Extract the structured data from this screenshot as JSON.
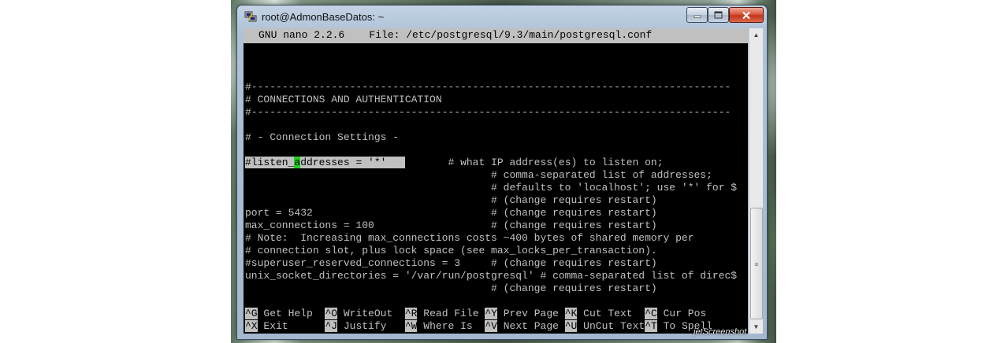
{
  "window": {
    "title": "root@AdmonBaseDatos: ~",
    "icon": "putty-icon",
    "controls": {
      "minimize": "minimize-icon",
      "maximize": "maximize-icon",
      "close": "close-icon"
    }
  },
  "nano": {
    "header": "GNU nano 2.2.6    File: /etc/postgresql/9.3/main/postgresql.conf",
    "lines": {
      "sep1": "#------------------------------------------------------------------------------",
      "section": "# CONNECTIONS AND AUTHENTICATION",
      "sep2": "#------------------------------------------------------------------------------",
      "conn_settings": "# - Connection Settings -",
      "listen_sel_a": "#listen_",
      "listen_cursor": "a",
      "listen_sel_b": "ddresses = '*'   ",
      "listen_comment": "       # what IP address(es) to listen on;",
      "c1": "                                        # comma-separated list of addresses;",
      "c2": "                                        # defaults to 'localhost'; use '*' for $",
      "c3": "                                        # (change requires restart)",
      "port": "port = 5432                             # (change requires restart)",
      "max_conn": "max_connections = 100                   # (change requires restart)",
      "note1": "# Note:  Increasing max_connections costs ~400 bytes of shared memory per",
      "note2": "# connection slot, plus lock space (see max_locks_per_transaction).",
      "superuser": "#superuser_reserved_connections = 3     # (change requires restart)",
      "unix_socket": "unix_socket_directories = '/var/run/postgresql' # comma-separated list of direc$",
      "c4": "                                        # (change requires restart)"
    },
    "shortcuts_row1": [
      {
        "key": "^G",
        "label": " Get Help  "
      },
      {
        "key": "^O",
        "label": " WriteOut  "
      },
      {
        "key": "^R",
        "label": " Read File "
      },
      {
        "key": "^Y",
        "label": " Prev Page "
      },
      {
        "key": "^K",
        "label": " Cut Text  "
      },
      {
        "key": "^C",
        "label": " Cur Pos"
      }
    ],
    "shortcuts_row2": [
      {
        "key": "^X",
        "label": " Exit      "
      },
      {
        "key": "^J",
        "label": " Justify   "
      },
      {
        "key": "^W",
        "label": " Where Is  "
      },
      {
        "key": "^V",
        "label": " Next Page "
      },
      {
        "key": "^U",
        "label": " UnCut Text"
      },
      {
        "key": "^T",
        "label": " To Spell"
      }
    ]
  },
  "scrollbar": {
    "up": "▲",
    "down": "▼",
    "grip": "≡"
  },
  "watermark": "jetScreenshot"
}
